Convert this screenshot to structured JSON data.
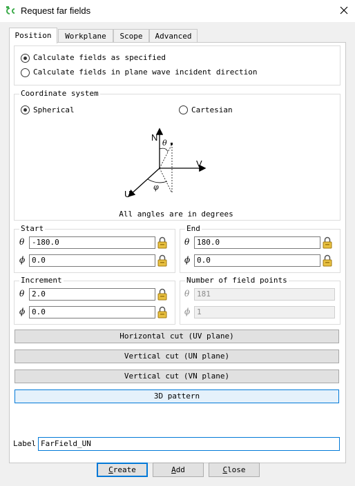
{
  "window": {
    "title": "Request far fields"
  },
  "tabs": [
    {
      "label": "Position"
    },
    {
      "label": "Workplane"
    },
    {
      "label": "Scope"
    },
    {
      "label": "Advanced"
    }
  ],
  "mode": {
    "opt1": "Calculate fields as specified",
    "opt2": "Calculate fields in plane wave incident direction"
  },
  "coord": {
    "legend": "Coordinate system",
    "spherical": "Spherical",
    "cartesian": "Cartesian",
    "diagram": {
      "N": "N",
      "V": "V",
      "U": "U",
      "theta": "θ",
      "phi": "φ"
    },
    "note": "All angles are in degrees"
  },
  "start": {
    "legend": "Start",
    "theta_sym": "θ",
    "theta": "-180.0",
    "phi_sym": "ϕ",
    "phi": "0.0"
  },
  "end": {
    "legend": "End",
    "theta_sym": "θ",
    "theta": "180.0",
    "phi_sym": "ϕ",
    "phi": "0.0"
  },
  "increment": {
    "legend": "Increment",
    "theta_sym": "θ",
    "theta": "2.0",
    "phi_sym": "ϕ",
    "phi": "0.0"
  },
  "points": {
    "legend": "Number of field points",
    "theta_sym": "θ",
    "theta": "181",
    "phi_sym": "ϕ",
    "phi": "1"
  },
  "cuts": {
    "horizontal": "Horizontal cut (UV plane)",
    "vertical_un": "Vertical cut (UN plane)",
    "vertical_vn": "Vertical cut (VN plane)",
    "pattern3d": "3D pattern"
  },
  "label": {
    "caption": "Label",
    "value": "FarField_UN"
  },
  "buttons": {
    "create_first": "C",
    "create_rest": "reate",
    "add_first": "A",
    "add_rest": "dd",
    "close_first": "C",
    "close_rest": "lose"
  },
  "colors": {
    "accent": "#0078d7",
    "lock": "#c8a020",
    "app_icon": "#3cab4a"
  }
}
